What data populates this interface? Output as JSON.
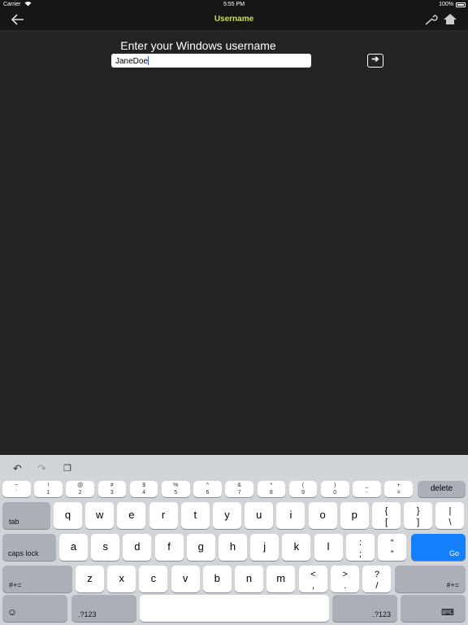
{
  "status_bar": {
    "carrier": "Carrier",
    "time": "5:55 PM",
    "battery": "100%"
  },
  "nav": {
    "title": "Username",
    "back_icon": "back-arrow-icon",
    "settings_icon": "wrench-icon",
    "home_icon": "home-icon"
  },
  "form": {
    "prompt": "Enter your Windows username",
    "username_value": "JaneDoe",
    "submit_icon": "arrow-right-icon"
  },
  "keyboard": {
    "toolbar": [
      "undo-icon",
      "redo-icon",
      "paste-icon"
    ],
    "row0": [
      {
        "top": "~",
        "bottom": "`"
      },
      {
        "top": "!",
        "bottom": "1"
      },
      {
        "top": "@",
        "bottom": "2"
      },
      {
        "top": "#",
        "bottom": "3"
      },
      {
        "top": "$",
        "bottom": "4"
      },
      {
        "top": "%",
        "bottom": "5"
      },
      {
        "top": "^",
        "bottom": "6"
      },
      {
        "top": "&",
        "bottom": "7"
      },
      {
        "top": "*",
        "bottom": "8"
      },
      {
        "top": "(",
        "bottom": "9"
      },
      {
        "top": ")",
        "bottom": "0"
      },
      {
        "top": "_",
        "bottom": "-"
      },
      {
        "top": "+",
        "bottom": "="
      }
    ],
    "delete": "delete",
    "tab": "tab",
    "row1": [
      "q",
      "w",
      "e",
      "r",
      "t",
      "y",
      "u",
      "i",
      "o",
      "p"
    ],
    "row1_symbols": [
      {
        "top": "{",
        "bottom": "["
      },
      {
        "top": "}",
        "bottom": "]"
      },
      {
        "top": "|",
        "bottom": "\\"
      }
    ],
    "caps_lock": "caps lock",
    "row2": [
      "a",
      "s",
      "d",
      "f",
      "g",
      "h",
      "j",
      "k",
      "l"
    ],
    "row2_symbols": [
      {
        "top": ":",
        "bottom": ";"
      },
      {
        "top": "“",
        "bottom": "”"
      }
    ],
    "go": "Go",
    "shift_left": "#+=",
    "row3": [
      "z",
      "x",
      "c",
      "v",
      "b",
      "n",
      "m"
    ],
    "row3_symbols": [
      {
        "top": "<",
        "bottom": ","
      },
      {
        "top": ">",
        "bottom": "."
      },
      {
        "top": "?",
        "bottom": "/"
      }
    ],
    "shift_right": "#+=",
    "emoji_icon": "emoji-icon",
    "numbers_left": ".?123",
    "numbers_right": ".?123",
    "dismiss_icon": "keyboard-dismiss-icon"
  }
}
